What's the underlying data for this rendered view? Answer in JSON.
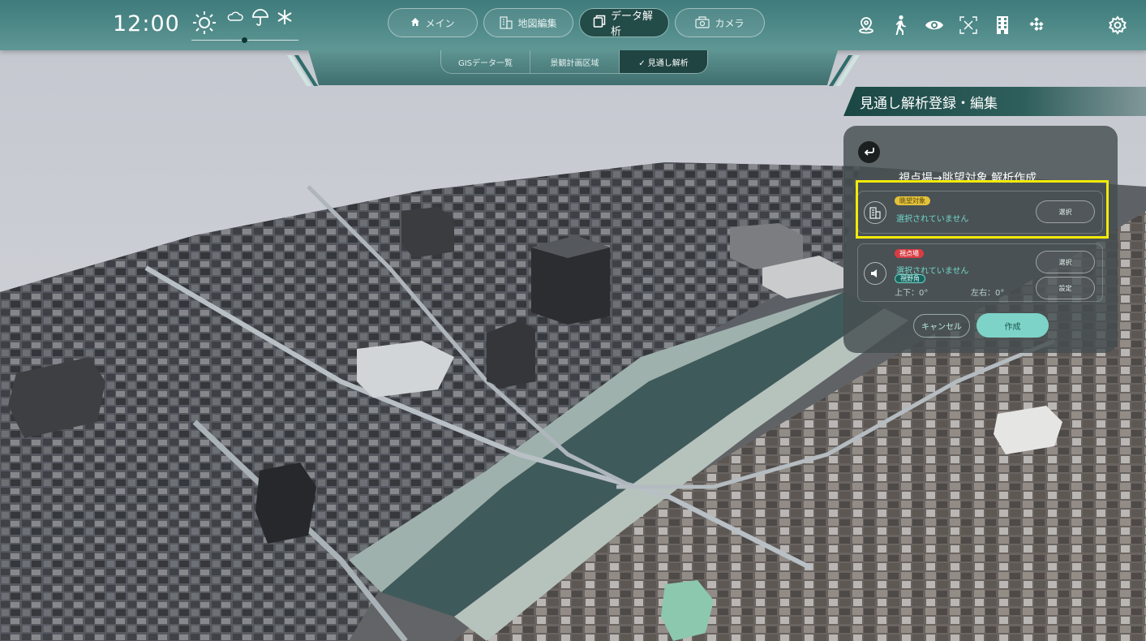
{
  "header": {
    "time": "12:00",
    "weather_icons": [
      "sun-icon",
      "cloud-icon",
      "umbrella-icon",
      "snowflake-icon"
    ],
    "nav": [
      {
        "label": "メイン",
        "icon": "home-icon"
      },
      {
        "label": "地図編集",
        "icon": "building-icon"
      },
      {
        "label": "データ解析",
        "icon": "copy-icon",
        "active": true
      },
      {
        "label": "カメラ",
        "icon": "camera-icon"
      }
    ],
    "tools": [
      "location-pin-icon",
      "walking-person-icon",
      "eye-icon",
      "focus-frame-icon",
      "tall-building-icon",
      "checker-pattern-icon"
    ],
    "settings_icon": "gear-icon"
  },
  "subtabs": [
    {
      "label": "GISデータ一覧"
    },
    {
      "label": "景観計画区域"
    },
    {
      "label": "✓ 見通し解析",
      "active": true
    }
  ],
  "panel": {
    "title": "見通し解析登録・編集",
    "subtitle": "視点場→眺望対象 解析作成",
    "card1": {
      "tag": "眺望対象",
      "status": "選択されていません",
      "button": "選択"
    },
    "card2": {
      "tag": "視点場",
      "status": "選択されていません",
      "tag2": "視野角",
      "angle_vertical": "上下：0°",
      "angle_horizontal": "左右：0°",
      "button1": "選択",
      "button2": "設定"
    },
    "cancel_label": "キャンセル",
    "create_label": "作成"
  },
  "colors": {
    "header": "#4f8a89",
    "accent": "#7dd3c7",
    "highlight": "#f2ea0a",
    "panel_bg": "#464e50"
  }
}
